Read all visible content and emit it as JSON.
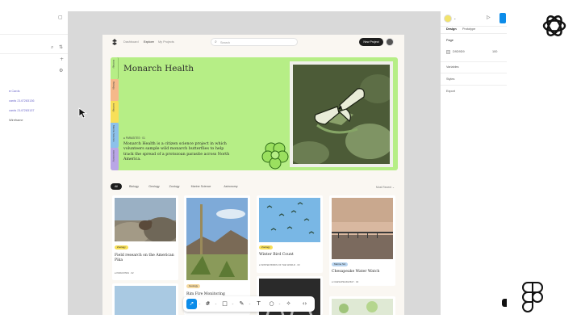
{
  "layers_panel": {
    "layers": [
      "● Cards",
      "cards 2147283136",
      "cards 2147283137",
      "Wireframe"
    ]
  },
  "frame": {
    "nav": {
      "links": [
        "Dashboard",
        "Explore",
        "My Projects"
      ],
      "search_placeholder": "Search",
      "new_project_label": "New Project"
    },
    "hero": {
      "title": "Monarch Health",
      "tag": "● PARASITES · 01",
      "description": "Monarch Health is a citizen science project in which volunteers sample wild monarch butterflies to help track the spread of a protozoan parasite across North America.",
      "tabs": [
        "Ecology",
        "Biology",
        "Ecology",
        "Marine Science",
        "Astronomy"
      ]
    },
    "filters": [
      "All",
      "Biology",
      "Geology",
      "Zoology",
      "Marine Science",
      "Astronomy"
    ],
    "sort_label": "Most Recent ⌄",
    "cards": [
      {
        "badge": "Zoology",
        "title": "Field research on the American Pika",
        "meta": "● PARASITES · 02"
      },
      {
        "badge": "Geology",
        "title": "Rim Fire Monitoring",
        "meta": ""
      },
      {
        "badge": "Zoology",
        "title": "Winter Bird Count",
        "meta": "● WINTER BIRDS OF THE WORLD · 03"
      },
      {
        "badge": "Marine Sci",
        "title": "Chesapeake Water Watch",
        "meta": "● CHESAPEAKE BAY · 04"
      }
    ]
  },
  "right_panel": {
    "tabs": [
      "Design",
      "Prototype"
    ],
    "page_label": "Page",
    "page_color": "D9D9D9",
    "page_opacity": "100",
    "sections": [
      "Variables",
      "Styles",
      "Export"
    ]
  },
  "colors": {
    "canvas": "#d9d9d9",
    "hero_green": "#b6ee86",
    "accent_blue": "#0c8ce9",
    "layer_purple": "#6b67c9"
  }
}
